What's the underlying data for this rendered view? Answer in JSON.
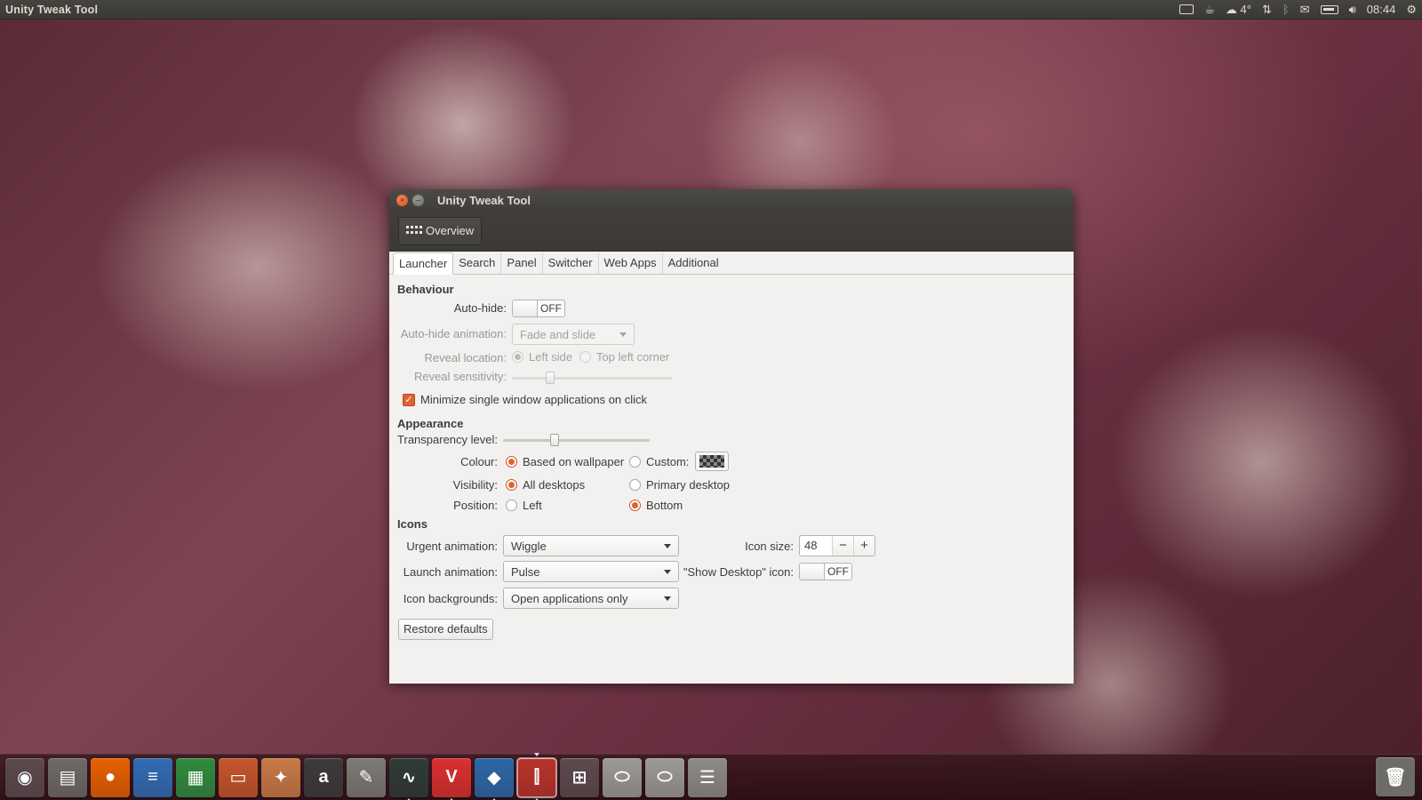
{
  "top_panel": {
    "app_title": "Unity Tweak Tool",
    "weather_temp": "4°",
    "clock": "08:44",
    "tray_icons": [
      "keyboard-icon",
      "coffee-icon",
      "weather-icon",
      "network-icon",
      "bluetooth-icon",
      "mail-icon",
      "battery-icon",
      "volume-icon",
      "session-gear-icon"
    ]
  },
  "window": {
    "title": "Unity Tweak Tool",
    "overview_label": "Overview",
    "tabs": [
      {
        "label": "Launcher",
        "active": true
      },
      {
        "label": "Search",
        "active": false
      },
      {
        "label": "Panel",
        "active": false
      },
      {
        "label": "Switcher",
        "active": false
      },
      {
        "label": "Web Apps",
        "active": false
      },
      {
        "label": "Additional",
        "active": false
      }
    ],
    "behaviour": {
      "heading": "Behaviour",
      "autohide_label": "Auto-hide:",
      "autohide_state": "OFF",
      "autohide_animation_label": "Auto-hide animation:",
      "autohide_animation_value": "Fade and slide",
      "reveal_location_label": "Reveal location:",
      "reveal_left": "Left side",
      "reveal_top": "Top left corner",
      "reveal_sensitivity_label": "Reveal sensitivity:",
      "reveal_sensitivity_level": 0.24,
      "minimize_label": "Minimize single window applications on click",
      "minimize_checked": true
    },
    "appearance": {
      "heading": "Appearance",
      "transparency_label": "Transparency level:",
      "transparency_level": 0.35,
      "colour_label": "Colour:",
      "colour_wallpaper": "Based on wallpaper",
      "colour_custom": "Custom:",
      "visibility_label": "Visibility:",
      "visibility_all": "All desktops",
      "visibility_primary": "Primary desktop",
      "position_label": "Position:",
      "position_left": "Left",
      "position_bottom": "Bottom"
    },
    "icons": {
      "heading": "Icons",
      "urgent_label": "Urgent animation:",
      "urgent_value": "Wiggle",
      "launch_label": "Launch animation:",
      "launch_value": "Pulse",
      "backgrounds_label": "Icon backgrounds:",
      "backgrounds_value": "Open applications only",
      "icon_size_label": "Icon size:",
      "icon_size_value": "48",
      "minus": "−",
      "plus": "+",
      "show_desktop_label": "\"Show Desktop\" icon:",
      "show_desktop_state": "OFF"
    },
    "restore_label": "Restore defaults"
  },
  "dock": {
    "items": [
      {
        "name": "dash-home-icon",
        "glyph": "◉",
        "bg": "#5a4a4e"
      },
      {
        "name": "files-icon",
        "glyph": "▤",
        "bg": "#6d6a66"
      },
      {
        "name": "firefox-icon",
        "glyph": "●",
        "bg": "#e66000"
      },
      {
        "name": "writer-icon",
        "glyph": "≡",
        "bg": "#2f6cb5"
      },
      {
        "name": "calc-icon",
        "glyph": "▦",
        "bg": "#2e8b3e"
      },
      {
        "name": "impress-icon",
        "glyph": "▭",
        "bg": "#c4552a"
      },
      {
        "name": "software-center-icon",
        "glyph": "✦",
        "bg": "#c77a45"
      },
      {
        "name": "amazon-icon",
        "glyph": "a",
        "bg": "#3a3a3a"
      },
      {
        "name": "system-settings-icon",
        "glyph": "✎",
        "bg": "#7c7a75"
      },
      {
        "name": "system-monitor-icon",
        "glyph": "∿",
        "bg": "#2d3b36"
      },
      {
        "name": "vivaldi-icon",
        "glyph": "V",
        "bg": "#d9302f"
      },
      {
        "name": "virtualbox-icon",
        "glyph": "◆",
        "bg": "#2a68a8"
      },
      {
        "name": "unity-tweak-tool-icon",
        "glyph": "⫿",
        "bg": "#b9332b"
      },
      {
        "name": "workspace-switcher-icon",
        "glyph": "⊞",
        "bg": "#5b4b4e"
      },
      {
        "name": "drive-icon",
        "glyph": "⬭",
        "bg": "#9b9a96"
      },
      {
        "name": "drive-2-icon",
        "glyph": "⬭",
        "bg": "#9b9a96"
      },
      {
        "name": "removable-drive-icon",
        "glyph": "☰",
        "bg": "#8c8b87"
      }
    ],
    "trash": "trash-icon"
  }
}
